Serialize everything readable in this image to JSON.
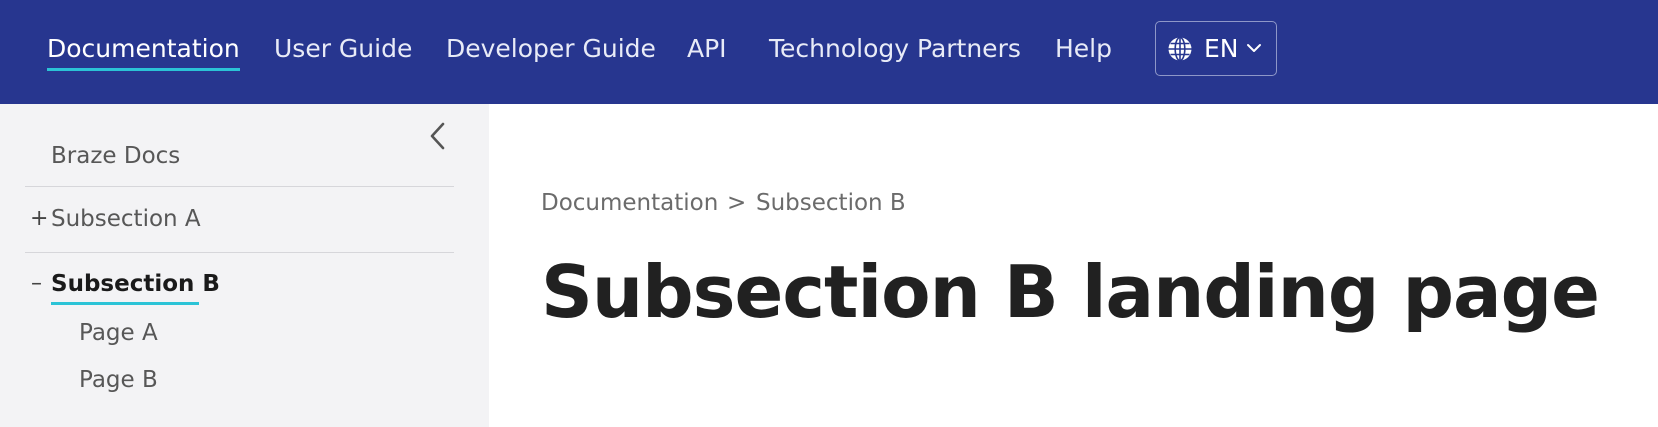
{
  "nav": {
    "items": [
      {
        "label": "Documentation",
        "active": true
      },
      {
        "label": "User Guide"
      },
      {
        "label": "Developer Guide"
      },
      {
        "label": "API"
      },
      {
        "label": "Technology Partners"
      },
      {
        "label": "Help"
      }
    ],
    "language": {
      "label": "EN",
      "icon": "globe-icon"
    }
  },
  "sidebar": {
    "root": "Braze Docs",
    "sections": [
      {
        "sign": "+",
        "label": "Subsection A",
        "expanded": false
      },
      {
        "sign": "–",
        "label": "Subsection B",
        "expanded": true,
        "current": true,
        "pages": [
          "Page A",
          "Page B"
        ]
      }
    ],
    "collapse_icon": "chevron-left-icon"
  },
  "breadcrumb": {
    "items": [
      "Documentation",
      "Subsection B"
    ],
    "separator": ">"
  },
  "page": {
    "title": "Subsection B landing page"
  },
  "colors": {
    "nav_bg": "#27368f",
    "accent": "#2bc3d6",
    "sidebar_bg": "#f3f3f5"
  }
}
